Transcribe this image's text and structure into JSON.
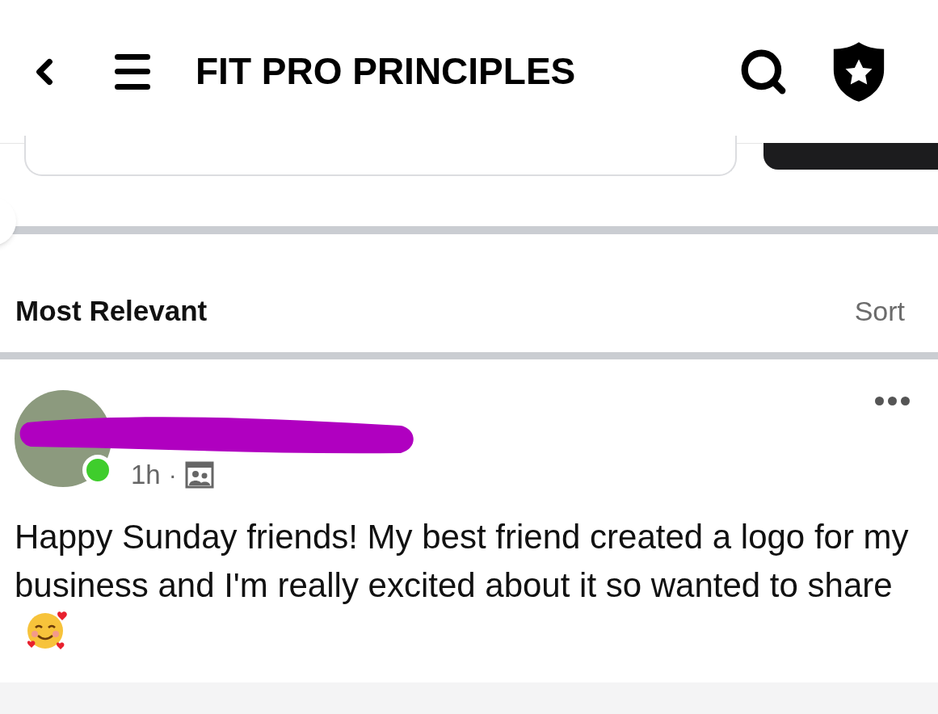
{
  "header": {
    "title": "FIT PRO PRINCIPLES"
  },
  "comments_bar": {
    "filter": "Most Relevant",
    "sort": "Sort"
  },
  "post": {
    "author_online": true,
    "time": "1h",
    "separator": "·",
    "text": "Happy Sunday friends! My best friend created a logo for my business and I'm really excited about it so wanted to share"
  }
}
